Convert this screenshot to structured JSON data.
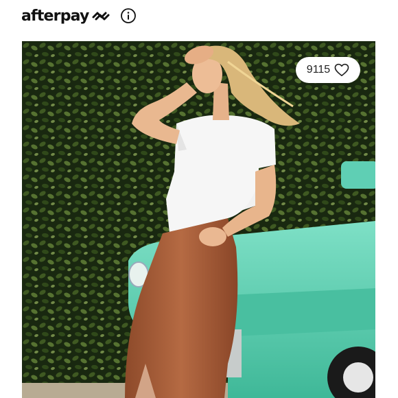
{
  "header": {
    "brand": "afterpay",
    "brand_mark_icon": "afterpay-arrows-icon",
    "info_icon": "info-icon"
  },
  "listing": {
    "like_count": "9115",
    "like_icon": "heart-outline-icon"
  },
  "colors": {
    "background": "#ffffff",
    "text": "#111111",
    "pill": "#ffffff"
  }
}
